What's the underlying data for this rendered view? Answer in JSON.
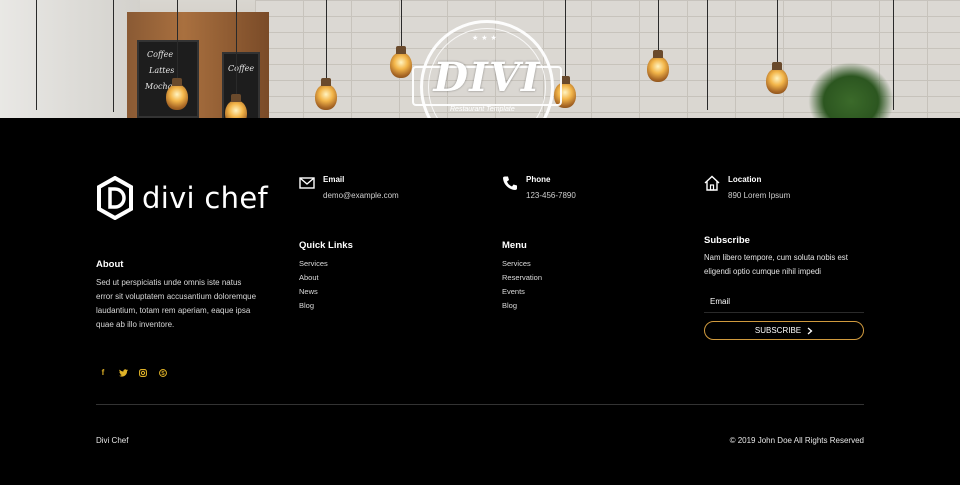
{
  "hero": {
    "logo_text": "DIVI",
    "logo_subtitle": "Restaurant Template"
  },
  "brand": {
    "name": "divi chef"
  },
  "about": {
    "title": "About",
    "text": "Sed ut perspiciatis unde omnis iste natus error sit voluptatem accusantium doloremque laudantium, totam rem aperiam, eaque ipsa quae ab illo inventore."
  },
  "social": [
    {
      "icon": "facebook-icon",
      "glyph": "f"
    },
    {
      "icon": "twitter-icon",
      "glyph": "t"
    },
    {
      "icon": "instagram-icon",
      "glyph": "o"
    },
    {
      "icon": "skype-icon",
      "glyph": "s"
    }
  ],
  "contact": {
    "email": {
      "label": "Email",
      "value": "demo@example.com"
    },
    "phone": {
      "label": "Phone",
      "value": "123-456-7890"
    },
    "location": {
      "label": "Location",
      "value": "890 Lorem Ipsum"
    }
  },
  "quick_links": {
    "title": "Quick Links",
    "items": [
      "Services",
      "About",
      "News",
      "Blog"
    ]
  },
  "menu": {
    "title": "Menu",
    "items": [
      "Services",
      "Reservation",
      "Events",
      "Blog"
    ]
  },
  "subscribe": {
    "title": "Subscribe",
    "text": "Nam libero tempore, cum soluta nobis est eligendi optio cumque nihil impedi",
    "input_placeholder": "Email",
    "button_label": "SUBSCRIBE",
    "button_icon": "chevron-right-icon"
  },
  "bottom": {
    "left": "Divi Chef",
    "right": "© 2019 John Doe All Rights Reserved"
  },
  "colors": {
    "accent": "#e0b227",
    "button_border": "#d09a3e",
    "background": "#000000"
  }
}
